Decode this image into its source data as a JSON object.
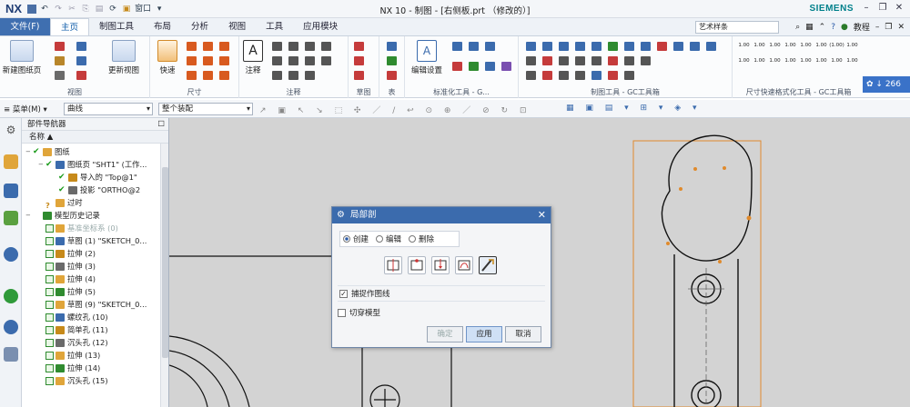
{
  "app": {
    "logo": "NX",
    "window_title": "NX 10 - 制图 - [右侧板.prt （修改的）]",
    "window_menu": "窗口",
    "brand": "SIEMENS"
  },
  "tabs": {
    "file": "文件(F)",
    "items": [
      "主页",
      "制图工具",
      "布局",
      "分析",
      "视图",
      "工具",
      "应用模块"
    ],
    "active": "主页"
  },
  "search": {
    "value": "艺术样条"
  },
  "tutorial": "教程",
  "ribbon": {
    "new_sheet": "新建图纸页",
    "update_view": "更新视图",
    "quick": "快速",
    "annotation": "注释",
    "edit_settings": "编辑设置",
    "groups": [
      "视图",
      "尺寸",
      "注释",
      "草图",
      "表",
      "标准化工具 - G...",
      "制图工具 - GC工具箱",
      "尺寸快速格式化工具 - GC工具箱"
    ],
    "badge": "266",
    "dim_labels": [
      "1.00",
      "1.00",
      "1.00",
      "1.00",
      "1.00",
      "1.00",
      "(1.00)",
      "1.00",
      "1.00",
      "1.00",
      "1.00",
      "1.00",
      "1.00",
      "1.00",
      "1.00",
      "1.00"
    ]
  },
  "toolbar2": {
    "menu": "菜单(M)",
    "filter": "曲线",
    "scope": "整个装配"
  },
  "navigator": {
    "title": "部件导航器",
    "col_name": "名称",
    "rows": [
      {
        "label": "图纸",
        "indent": 0,
        "exp": "−",
        "check": "green"
      },
      {
        "label": "图纸页 \"SHT1\" (工作...",
        "indent": 1,
        "exp": "−",
        "check": "green"
      },
      {
        "label": "导入的 \"Top@1\"",
        "indent": 2,
        "exp": "",
        "check": "green"
      },
      {
        "label": "投影 \"ORTHO@2",
        "indent": 2,
        "exp": "",
        "check": "green"
      },
      {
        "label": "过时",
        "indent": 1,
        "exp": "",
        "check": "question"
      },
      {
        "label": "模型历史记录",
        "indent": 0,
        "exp": "−",
        "check": ""
      },
      {
        "label": "基准坐标系 (0)",
        "indent": 1,
        "exp": "",
        "check": "box",
        "dim": true
      },
      {
        "label": "草图 (1) \"SKETCH_0...",
        "indent": 1,
        "exp": "",
        "check": "box"
      },
      {
        "label": "拉伸 (2)",
        "indent": 1,
        "exp": "",
        "check": "box"
      },
      {
        "label": "拉伸 (3)",
        "indent": 1,
        "exp": "",
        "check": "box"
      },
      {
        "label": "拉伸 (4)",
        "indent": 1,
        "exp": "",
        "check": "box"
      },
      {
        "label": "拉伸 (5)",
        "indent": 1,
        "exp": "",
        "check": "box"
      },
      {
        "label": "草图 (9) \"SKETCH_0...",
        "indent": 1,
        "exp": "",
        "check": "box"
      },
      {
        "label": "螺纹孔 (10)",
        "indent": 1,
        "exp": "",
        "check": "box"
      },
      {
        "label": "简单孔 (11)",
        "indent": 1,
        "exp": "",
        "check": "box"
      },
      {
        "label": "沉头孔 (12)",
        "indent": 1,
        "exp": "",
        "check": "box"
      },
      {
        "label": "拉伸 (13)",
        "indent": 1,
        "exp": "",
        "check": "box"
      },
      {
        "label": "拉伸 (14)",
        "indent": 1,
        "exp": "",
        "check": "box"
      },
      {
        "label": "沉头孔 (15)",
        "indent": 1,
        "exp": "",
        "check": "box"
      }
    ]
  },
  "dialog": {
    "title": "局部剖",
    "radios": [
      "创建",
      "编辑",
      "删除"
    ],
    "selected": "创建",
    "option1": "捕捉作图线",
    "option1_checked": true,
    "option2": "切穿模型",
    "option2_checked": false,
    "ok": "确定",
    "apply": "应用",
    "cancel": "取消"
  },
  "colors": {
    "accent": "#3b6bad",
    "file_tab": "#3f6fb0",
    "canvas": "#d3d3d3",
    "view_border": "#e08a2c"
  }
}
